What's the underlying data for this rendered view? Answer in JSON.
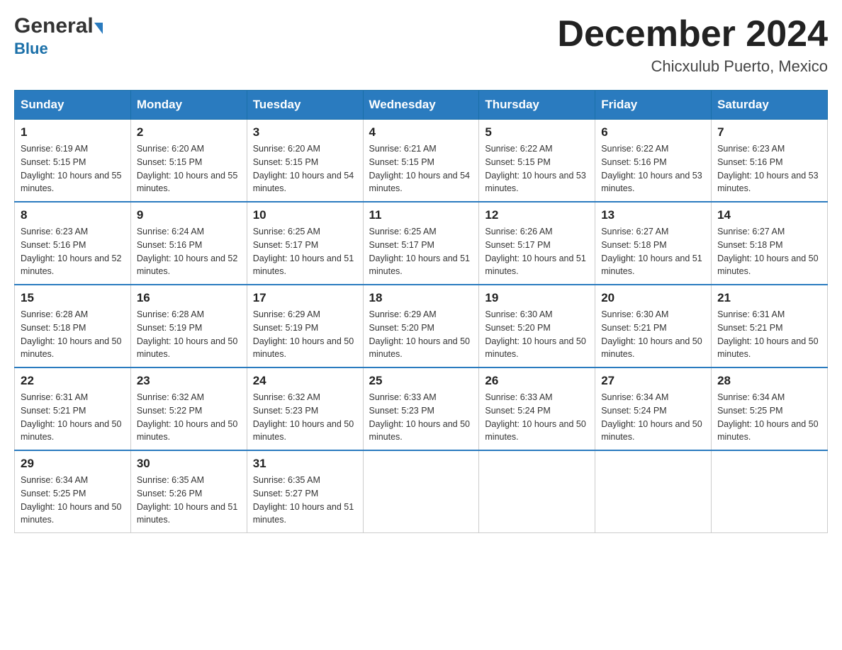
{
  "header": {
    "logo_general": "General",
    "logo_blue": "Blue",
    "month_title": "December 2024",
    "location": "Chicxulub Puerto, Mexico"
  },
  "days_of_week": [
    "Sunday",
    "Monday",
    "Tuesday",
    "Wednesday",
    "Thursday",
    "Friday",
    "Saturday"
  ],
  "weeks": [
    [
      {
        "day": "1",
        "sunrise": "6:19 AM",
        "sunset": "5:15 PM",
        "daylight": "10 hours and 55 minutes."
      },
      {
        "day": "2",
        "sunrise": "6:20 AM",
        "sunset": "5:15 PM",
        "daylight": "10 hours and 55 minutes."
      },
      {
        "day": "3",
        "sunrise": "6:20 AM",
        "sunset": "5:15 PM",
        "daylight": "10 hours and 54 minutes."
      },
      {
        "day": "4",
        "sunrise": "6:21 AM",
        "sunset": "5:15 PM",
        "daylight": "10 hours and 54 minutes."
      },
      {
        "day": "5",
        "sunrise": "6:22 AM",
        "sunset": "5:15 PM",
        "daylight": "10 hours and 53 minutes."
      },
      {
        "day": "6",
        "sunrise": "6:22 AM",
        "sunset": "5:16 PM",
        "daylight": "10 hours and 53 minutes."
      },
      {
        "day": "7",
        "sunrise": "6:23 AM",
        "sunset": "5:16 PM",
        "daylight": "10 hours and 53 minutes."
      }
    ],
    [
      {
        "day": "8",
        "sunrise": "6:23 AM",
        "sunset": "5:16 PM",
        "daylight": "10 hours and 52 minutes."
      },
      {
        "day": "9",
        "sunrise": "6:24 AM",
        "sunset": "5:16 PM",
        "daylight": "10 hours and 52 minutes."
      },
      {
        "day": "10",
        "sunrise": "6:25 AM",
        "sunset": "5:17 PM",
        "daylight": "10 hours and 51 minutes."
      },
      {
        "day": "11",
        "sunrise": "6:25 AM",
        "sunset": "5:17 PM",
        "daylight": "10 hours and 51 minutes."
      },
      {
        "day": "12",
        "sunrise": "6:26 AM",
        "sunset": "5:17 PM",
        "daylight": "10 hours and 51 minutes."
      },
      {
        "day": "13",
        "sunrise": "6:27 AM",
        "sunset": "5:18 PM",
        "daylight": "10 hours and 51 minutes."
      },
      {
        "day": "14",
        "sunrise": "6:27 AM",
        "sunset": "5:18 PM",
        "daylight": "10 hours and 50 minutes."
      }
    ],
    [
      {
        "day": "15",
        "sunrise": "6:28 AM",
        "sunset": "5:18 PM",
        "daylight": "10 hours and 50 minutes."
      },
      {
        "day": "16",
        "sunrise": "6:28 AM",
        "sunset": "5:19 PM",
        "daylight": "10 hours and 50 minutes."
      },
      {
        "day": "17",
        "sunrise": "6:29 AM",
        "sunset": "5:19 PM",
        "daylight": "10 hours and 50 minutes."
      },
      {
        "day": "18",
        "sunrise": "6:29 AM",
        "sunset": "5:20 PM",
        "daylight": "10 hours and 50 minutes."
      },
      {
        "day": "19",
        "sunrise": "6:30 AM",
        "sunset": "5:20 PM",
        "daylight": "10 hours and 50 minutes."
      },
      {
        "day": "20",
        "sunrise": "6:30 AM",
        "sunset": "5:21 PM",
        "daylight": "10 hours and 50 minutes."
      },
      {
        "day": "21",
        "sunrise": "6:31 AM",
        "sunset": "5:21 PM",
        "daylight": "10 hours and 50 minutes."
      }
    ],
    [
      {
        "day": "22",
        "sunrise": "6:31 AM",
        "sunset": "5:21 PM",
        "daylight": "10 hours and 50 minutes."
      },
      {
        "day": "23",
        "sunrise": "6:32 AM",
        "sunset": "5:22 PM",
        "daylight": "10 hours and 50 minutes."
      },
      {
        "day": "24",
        "sunrise": "6:32 AM",
        "sunset": "5:23 PM",
        "daylight": "10 hours and 50 minutes."
      },
      {
        "day": "25",
        "sunrise": "6:33 AM",
        "sunset": "5:23 PM",
        "daylight": "10 hours and 50 minutes."
      },
      {
        "day": "26",
        "sunrise": "6:33 AM",
        "sunset": "5:24 PM",
        "daylight": "10 hours and 50 minutes."
      },
      {
        "day": "27",
        "sunrise": "6:34 AM",
        "sunset": "5:24 PM",
        "daylight": "10 hours and 50 minutes."
      },
      {
        "day": "28",
        "sunrise": "6:34 AM",
        "sunset": "5:25 PM",
        "daylight": "10 hours and 50 minutes."
      }
    ],
    [
      {
        "day": "29",
        "sunrise": "6:34 AM",
        "sunset": "5:25 PM",
        "daylight": "10 hours and 50 minutes."
      },
      {
        "day": "30",
        "sunrise": "6:35 AM",
        "sunset": "5:26 PM",
        "daylight": "10 hours and 51 minutes."
      },
      {
        "day": "31",
        "sunrise": "6:35 AM",
        "sunset": "5:27 PM",
        "daylight": "10 hours and 51 minutes."
      },
      null,
      null,
      null,
      null
    ]
  ]
}
